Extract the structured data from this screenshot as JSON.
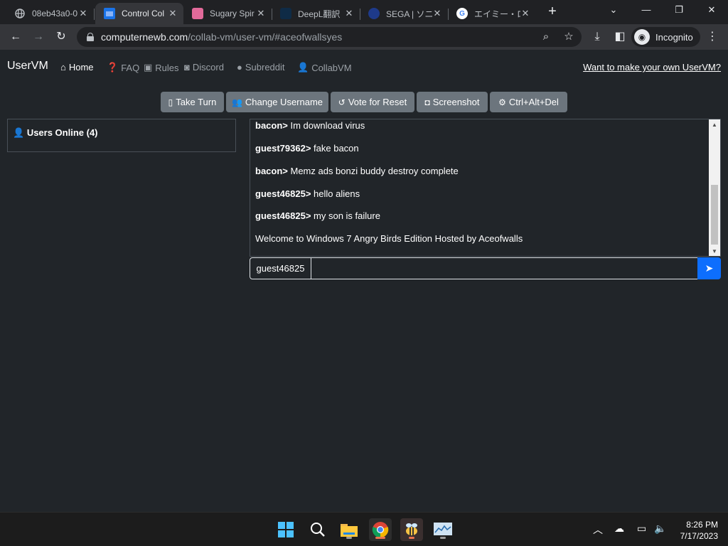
{
  "browser": {
    "tabs": [
      {
        "title": "08eb43a0-0",
        "icon": "globe-icon"
      },
      {
        "title": "Control Col",
        "icon": "monitor-icon",
        "active": true
      },
      {
        "title": "Sugary Spir",
        "icon": "pink-image-icon"
      },
      {
        "title": "DeepL翻訳",
        "icon": "deepl-icon"
      },
      {
        "title": "SEGA | ソニ",
        "icon": "sega-icon"
      },
      {
        "title": "エイミー・ロー",
        "icon": "google-icon"
      }
    ],
    "url_host": "computernewb.com",
    "url_path": "/collab-vm/user-vm/#aceofwallsyes",
    "incognito_label": "Incognito"
  },
  "site": {
    "brand": "UserVM",
    "nav": [
      {
        "label": "Home",
        "icon": "home-icon"
      },
      {
        "label": "FAQ",
        "icon": "question-icon"
      },
      {
        "label": "Rules",
        "icon": "clipboard-icon"
      },
      {
        "label": "Discord",
        "icon": "discord-icon"
      },
      {
        "label": "Subreddit",
        "icon": "reddit-icon"
      },
      {
        "label": "CollabVM",
        "icon": "user-icon"
      }
    ],
    "own_vm_link": "Want to make your own UserVM?"
  },
  "vm_buttons": [
    {
      "label": "Take Turn",
      "icon": "mouse-icon"
    },
    {
      "label": "Change Username",
      "icon": "users-icon"
    },
    {
      "label": "Vote for Reset",
      "icon": "undo-icon"
    },
    {
      "label": "Screenshot",
      "icon": "camera-icon"
    },
    {
      "label": "Ctrl+Alt+Del",
      "icon": "gear-icon"
    }
  ],
  "users_panel": {
    "title": "Users Online (4)"
  },
  "chat": {
    "messages": [
      {
        "user": "bacon>",
        "text": " Im download virus"
      },
      {
        "user": "guest79362>",
        "text": " fake bacon"
      },
      {
        "user": "bacon>",
        "text": " Memz ads bonzi buddy destroy complete"
      },
      {
        "user": "guest46825>",
        "text": " hello aliens"
      },
      {
        "user": "guest46825>",
        "text": " my son is failure"
      },
      {
        "user": "",
        "text": "Welcome to Windows 7 Angry Birds Edition Hosted by Aceofwalls"
      }
    ],
    "username": "guest46825",
    "input_value": ""
  },
  "taskbar": {
    "apps": [
      "windows-start-icon",
      "search-icon",
      "file-explorer-icon",
      "chrome-icon",
      "bee-app-icon",
      "monitor-app-icon"
    ],
    "time": "8:26 PM",
    "date": "7/17/2023"
  }
}
